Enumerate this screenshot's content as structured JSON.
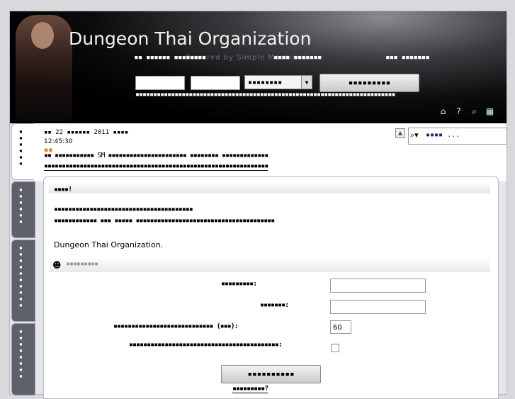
{
  "header": {
    "site_title": "Dungeon Thai Organization",
    "powered_by": "Powered by Simple Machines",
    "nav_left": "▪▪ ▪▪▪▪▪▪ ▪▪▪▪▪▪▪▪",
    "nav_mid": "▪▪▪▪ ▪▪▪▪▪▪▪",
    "nav_right": "▪▪▪ ▪▪▪▪▪▪▪",
    "login_button": "▪▪▪▪▪▪▪▪▪",
    "session_select": "▪▪▪▪▪▪▪▪",
    "login_hint": "▪▪▪▪▪▪▪▪▪▪▪▪▪▪▪▪▪▪▪▪▪▪▪▪▪▪▪▪▪▪▪▪▪▪▪▪▪▪▪▪▪▪▪▪▪▪▪▪▪▪▪▪▪▪▪▪▪▪▪▪▪▪▪▪▪▪▪▪▪▪▪▪▪",
    "icons": [
      "home-icon",
      "help-icon",
      "search-icon",
      "calendar-icon"
    ]
  },
  "infobar": {
    "date": "▪▪ 22 ▪▪▪▪▪▪ 2011 ▪▪▪▪",
    "time": "12:45:30",
    "news_line_1": "▪▪ ▪▪▪▪▪▪▪▪▪▪▪ SM ▪▪▪▪▪▪▪▪▪▪▪▪▪▪▪▪▪▪▪▪▪▪ ▪▪▪▪▪▪▪▪ ▪▪▪▪▪▪▪▪▪▪▪▪▪",
    "news_line_2": "▪▪▪▪▪▪▪▪▪▪▪▪▪▪▪▪▪▪▪▪▪▪▪▪▪▪▪▪▪▪▪▪▪▪▪▪▪▪▪▪▪▪▪▪▪▪▪▪▪▪▪▪▪▪▪▪▪▪▪▪▪▪▪",
    "search_placeholder": "▪▪▪▪ ..."
  },
  "main": {
    "warning_title": "▪▪▪▪!",
    "warning_line_1": "▪▪▪▪▪▪▪▪▪▪▪▪▪▪▪▪▪▪▪▪▪▪▪▪▪▪▪▪▪▪▪▪▪▪▪▪▪▪▪",
    "warning_line_2": "▪▪▪▪▪▪▪▪▪▪▪▪ ▪▪▪ ▪▪▪▪▪ ▪▪▪▪▪▪▪▪▪▪▪▪▪▪▪▪▪▪▪▪▪▪▪▪▪▪▪▪▪▪▪▪▪▪▪▪▪▪▪",
    "org_name": "Dungeon Thai Organization.",
    "login_section_title": "▪▪▪▪▪▪▪▪▪",
    "username_label": "▪▪▪▪▪▪▪▪▪:",
    "password_label": "▪▪▪▪▪▪▪:",
    "minutes_label": "▪▪▪▪▪▪▪▪▪▪▪▪▪▪▪▪▪▪▪▪▪▪▪▪▪▪▪▪ (▪▪▪):",
    "minutes_value": "60",
    "always_label": "▪▪▪▪▪▪▪▪▪▪▪▪▪▪▪▪▪▪▪▪▪▪▪▪▪▪▪▪▪▪▪▪▪▪▪▪▪▪▪▪▪▪:",
    "submit_button": "▪▪▪▪▪▪▪▪▪▪",
    "forgot_link": "▪▪▪▪▪▪▪▪▪?"
  }
}
